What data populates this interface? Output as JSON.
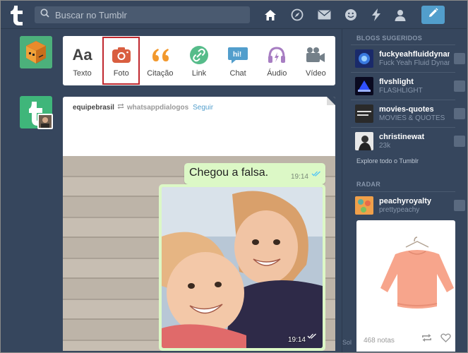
{
  "header": {
    "search_placeholder": "Buscar no Tumblr",
    "icons": [
      "home-icon",
      "explore-icon",
      "mail-icon",
      "emoji-icon",
      "activity-icon",
      "account-icon",
      "compose-icon"
    ]
  },
  "post_types": [
    {
      "label": "Texto",
      "icon": "text-icon",
      "color": "#444444"
    },
    {
      "label": "Foto",
      "icon": "photo-icon",
      "color": "#d95e40",
      "selected": true
    },
    {
      "label": "Citação",
      "icon": "quote-icon",
      "color": "#f2992e"
    },
    {
      "label": "Link",
      "icon": "link-icon",
      "color": "#56bc8a"
    },
    {
      "label": "Chat",
      "icon": "chat-icon",
      "color": "#529ecc"
    },
    {
      "label": "Áudio",
      "icon": "audio-icon",
      "color": "#a77dc2"
    },
    {
      "label": "Vídeo",
      "icon": "video-icon",
      "color": "#748089"
    }
  ],
  "post": {
    "user": "equipebrasil",
    "source": "whatsappdialogos",
    "follow": "Seguir",
    "message": "Chegou a falsa.",
    "time_top": "19:14",
    "time_photo": "19:14"
  },
  "sidebar": {
    "suggested_title": "BLOGS SUGERIDOS",
    "blogs": [
      {
        "name": "fuckyeahfluiddynamics",
        "subtitle": "Fuck Yeah Fluid Dynamics"
      },
      {
        "name": "flvshlight",
        "subtitle": "FLASHLIGHT"
      },
      {
        "name": "movies-quotes",
        "subtitle": "MOVIES & QUOTES"
      },
      {
        "name": "christinewat",
        "subtitle": "23k"
      }
    ],
    "explore": "Explore todo o Tumblr",
    "radar_title": "RADAR",
    "radar": {
      "name": "peachyroyalty",
      "subtitle": "prettypeachy",
      "notes": "468 notas"
    }
  },
  "footer": {
    "sol": "Sol"
  },
  "colors": {
    "background": "#36465d",
    "accent": "#529ecc",
    "selection": "#c0282e"
  }
}
